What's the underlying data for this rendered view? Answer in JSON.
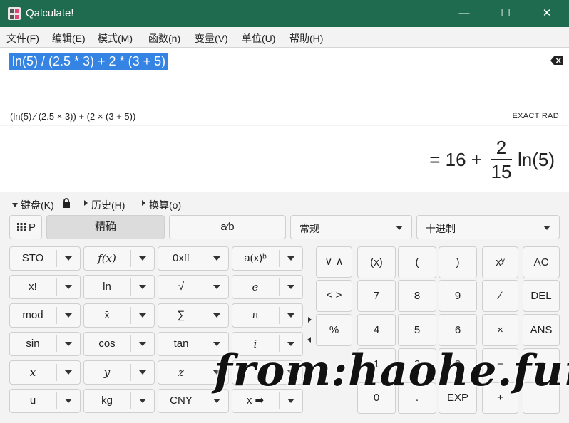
{
  "window": {
    "title": "Qalculate!",
    "controls": {
      "minimize": "—",
      "maximize": "☐",
      "close": "✕"
    }
  },
  "menu": [
    "文件(F)",
    "编辑(E)",
    "模式(M)",
    "函数(n)",
    "变量(V)",
    "单位(U)",
    "帮助(H)"
  ],
  "expression": {
    "text": "ln(5) / (2.5 * 3) + 2 * (3 + 5)"
  },
  "parsed": {
    "text": "(ln(5) ∕ (2.5 × 3)) + (2 × (3 + 5))",
    "mode": "EXACT  RAD"
  },
  "result": {
    "prefix": "= 16 +",
    "numerator": "2",
    "denominator": "15",
    "suffix": "ln(5)"
  },
  "expanders": {
    "keyboard": "键盘(K)",
    "history": "历史(H)",
    "conversion": "换算(o)"
  },
  "toolbar": {
    "keypad_toggle": "P",
    "exact": "精确",
    "fraction": "a∕b",
    "format": "常规",
    "base": "十进制"
  },
  "function_keys": [
    [
      "STO",
      "f(x)",
      "0xff",
      "a(x)ᵇ"
    ],
    [
      "x!",
      "ln",
      "√",
      "e"
    ],
    [
      "mod",
      "x̄",
      "∑",
      "π"
    ],
    [
      "sin",
      "cos",
      "tan",
      "i"
    ],
    [
      "x",
      "y",
      "z",
      ""
    ],
    [
      "u",
      "kg",
      "CNY",
      "x ➡"
    ]
  ],
  "numpad": {
    "nav": [
      "∨ ∧",
      "< >",
      "%"
    ],
    "row1": [
      "(x)",
      "(",
      ")",
      "xʸ",
      "AC"
    ],
    "row2": [
      "7",
      "8",
      "9",
      "∕",
      "DEL"
    ],
    "row3": [
      "4",
      "5",
      "6",
      "×",
      "ANS"
    ],
    "row4": [
      "1",
      "2",
      "3",
      "−",
      "="
    ],
    "row5": [
      "0",
      ".",
      "EXP",
      "+",
      ""
    ]
  },
  "watermark": "from:haohe.fun",
  "colors": {
    "titlebar": "#1f6b4f",
    "selection": "#3584e4"
  }
}
